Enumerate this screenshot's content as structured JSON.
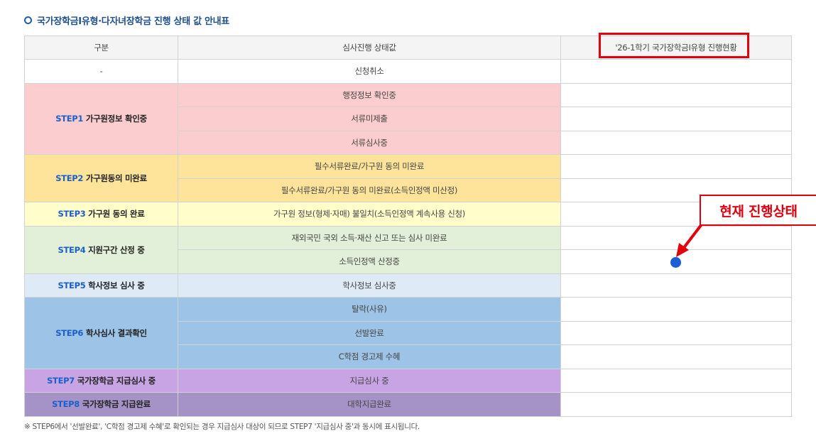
{
  "section_title": "국가장학금Ⅰ유형·다자녀장학금 진행 상태 값 안내표",
  "table": {
    "headers": [
      "구분",
      "심사진행 상태값",
      "'26-1학기 국가장학금Ⅰ유형 진행현황"
    ],
    "cancel_row": {
      "category": "-",
      "status": "신청취소"
    },
    "groups": [
      {
        "num": "STEP1",
        "label": "가구원정보 확인중",
        "color": "#fccdce",
        "statuses": [
          "행정정보 확인중",
          "서류미제출",
          "서류심사중"
        ]
      },
      {
        "num": "STEP2",
        "label": "가구원동의 미완료",
        "color": "#fde49a",
        "statuses": [
          "필수서류완료/가구원 동의 미완료",
          "필수서류완료/가구원 동의 미완료(소득인정액 미산정)"
        ]
      },
      {
        "num": "STEP3",
        "label": "가구원 동의 완료",
        "color": "#fffdca",
        "statuses": [
          "가구원 정보(형제·자매) 불일치(소득인정액 계속사용 신청)"
        ]
      },
      {
        "num": "STEP4",
        "label": "지원구간 산정 중",
        "color": "#e2efd9",
        "statuses": [
          "재외국민 국외 소득·재산 신고 또는 심사 미완료",
          "소득인정액 산정중"
        ]
      },
      {
        "num": "STEP5",
        "label": "학사정보 심사 중",
        "color": "#deebf6",
        "statuses": [
          "학사정보 심사중"
        ]
      },
      {
        "num": "STEP6",
        "label": "학사심사 결과확인",
        "color": "#9dc3e6",
        "statuses": [
          "탈락(사유)",
          "선발완료",
          "C학점 경고제 수혜"
        ]
      },
      {
        "num": "STEP7",
        "label": "국가장학금 지급심사 중",
        "color": "#c9a4e4",
        "statuses": [
          "지급심사 중"
        ]
      },
      {
        "num": "STEP8",
        "label": "국가장학금 지급완료",
        "color": "#a593c7",
        "statuses": [
          "대학지급완료"
        ]
      }
    ]
  },
  "footnote": "※ STEP6에서 '선발완료', 'C학점 경고제 수혜'로 확인되는 경우 지급심사 대상이 되므로 STEP7 '지급심사 중'과 동시에 표시됩니다.",
  "callout": {
    "text": "현재 진행상태",
    "color": "#e2000f"
  },
  "current_indicator": {
    "group": "STEP4",
    "status": "소득인정액 산정중",
    "color": "#1a5fd6"
  }
}
